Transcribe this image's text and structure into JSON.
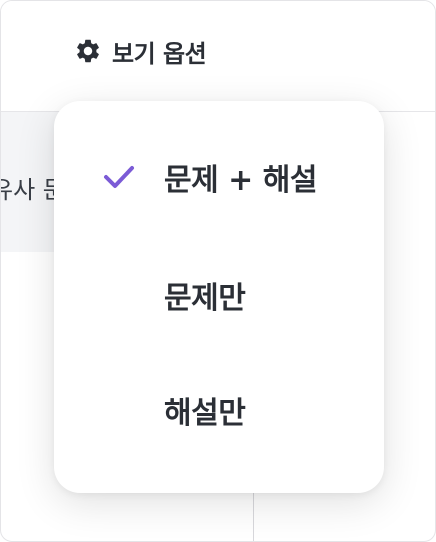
{
  "toolbar": {
    "view_options_label": "보기 옵션",
    "view_options_icon": "gear-icon"
  },
  "background": {
    "similar_label": "유사 문"
  },
  "menu": {
    "items": [
      {
        "label": "문제 + 해설",
        "selected": true
      },
      {
        "label": "문제만",
        "selected": false
      },
      {
        "label": "해설만",
        "selected": false
      }
    ],
    "check_icon": "check-icon",
    "accent_color": "#7b5bd6"
  }
}
